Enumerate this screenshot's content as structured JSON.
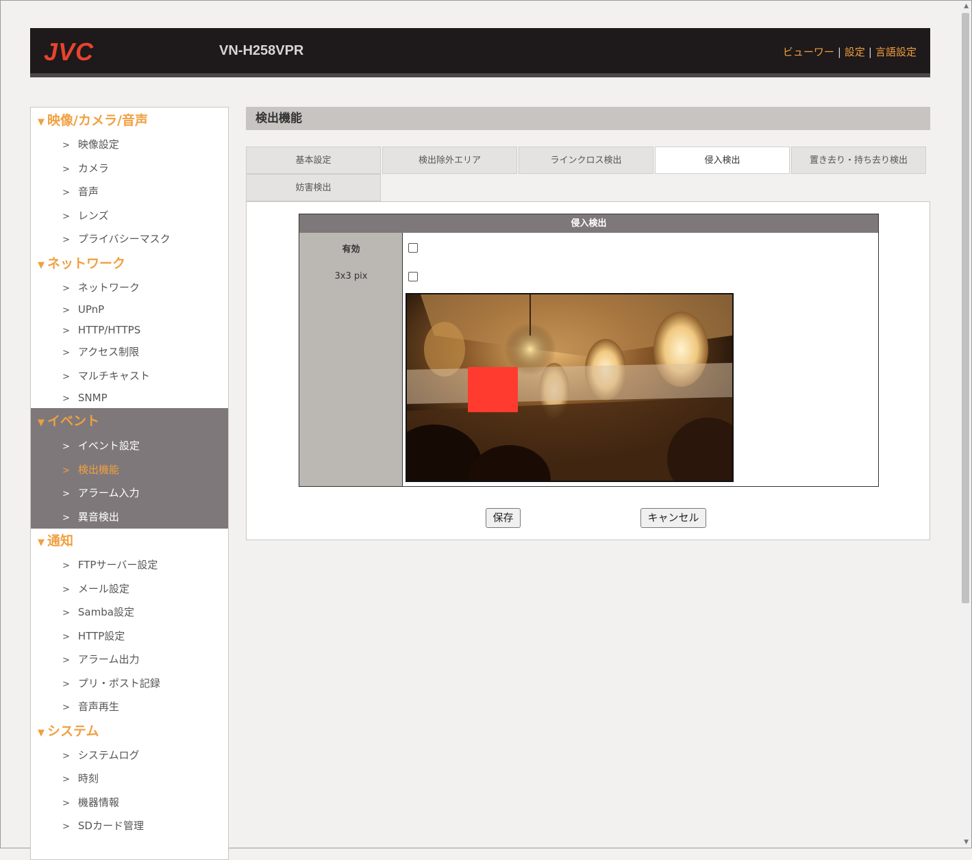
{
  "header": {
    "logo": "JVC",
    "model": "VN-H258VPR",
    "links": [
      "ビューワー",
      "設定",
      "言語設定"
    ],
    "separator": "|"
  },
  "sidebar": {
    "sections": [
      {
        "title": "映像/カメラ/音声",
        "items": [
          "映像設定",
          "カメラ",
          "音声",
          "レンズ",
          "プライバシーマスク"
        ]
      },
      {
        "title": "ネットワーク",
        "items": [
          "ネットワーク",
          "UPnP",
          "HTTP/HTTPS",
          "アクセス制限",
          "マルチキャスト",
          "SNMP"
        ]
      },
      {
        "title": "イベント",
        "items": [
          "イベント設定",
          "検出機能",
          "アラーム入力",
          "異音検出"
        ],
        "active_item": "検出機能"
      },
      {
        "title": "通知",
        "items": [
          "FTPサーバー設定",
          "メール設定",
          "Samba設定",
          "HTTP設定",
          "アラーム出力",
          "プリ・ポスト記録",
          "音声再生"
        ]
      },
      {
        "title": "システム",
        "items": [
          "システムログ",
          "時刻",
          "機器情報",
          "SDカード管理"
        ]
      }
    ],
    "triangle": "▼",
    "bullet": ">"
  },
  "main": {
    "title": "検出機能",
    "tabs": [
      "基本設定",
      "検出除外エリア",
      "ラインクロス検出",
      "侵入検出",
      "置き去り・持ち去り検出",
      "妨害検出"
    ],
    "active_tab": "侵入検出",
    "table": {
      "header": "侵入検出",
      "rows": [
        {
          "label": "有効",
          "checked": false
        },
        {
          "label": "3x3 pix",
          "checked": false
        }
      ]
    },
    "buttons": {
      "save": "保存",
      "cancel": "キャンセル"
    }
  },
  "colors": {
    "accent": "#f0a040",
    "header_bg": "#1e191a",
    "logo": "#e8432e",
    "region_marker": "#ff3b2f",
    "event_bg": "#7e787a"
  }
}
